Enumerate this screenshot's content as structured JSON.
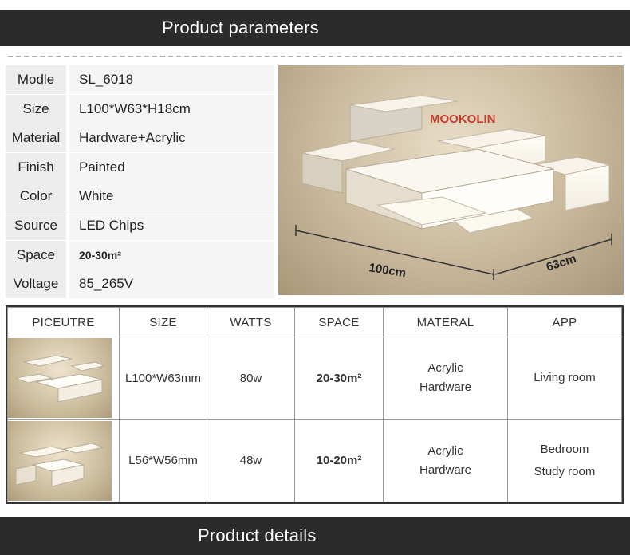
{
  "banner_top": "Product parameters",
  "banner_bottom": "Product details",
  "params": [
    {
      "label": "Modle",
      "value": "SL_6018"
    },
    {
      "label": "Size",
      "value": "L100*W63*H18cm"
    },
    {
      "label": "Material",
      "value": "Hardware+Acrylic"
    },
    {
      "label": "Finish",
      "value": "Painted"
    },
    {
      "label": "Color",
      "value": "White"
    },
    {
      "label": "Source",
      "value": "LED Chips"
    },
    {
      "label": "Space",
      "value": "20-30m²"
    },
    {
      "label": "Voltage",
      "value": "85_265V"
    }
  ],
  "photo": {
    "watermark": "MOOKOLIN",
    "dim_length": "100cm",
    "dim_width": "63cm"
  },
  "table": {
    "headers": [
      "PICEUTRE",
      "SIZE",
      "WATTS",
      "SPACE",
      "MATERAL",
      "APP"
    ],
    "rows": [
      {
        "size": "L100*W63mm",
        "watts": "80w",
        "space": "20-30m²",
        "material1": "Acrylic",
        "material2": "Hardware",
        "app1": "Living room",
        "app2": ""
      },
      {
        "size": "L56*W56mm",
        "watts": "48w",
        "space": "10-20m²",
        "material1": "Acrylic",
        "material2": "Hardware",
        "app1": "Bedroom",
        "app2": "Study room"
      }
    ]
  }
}
